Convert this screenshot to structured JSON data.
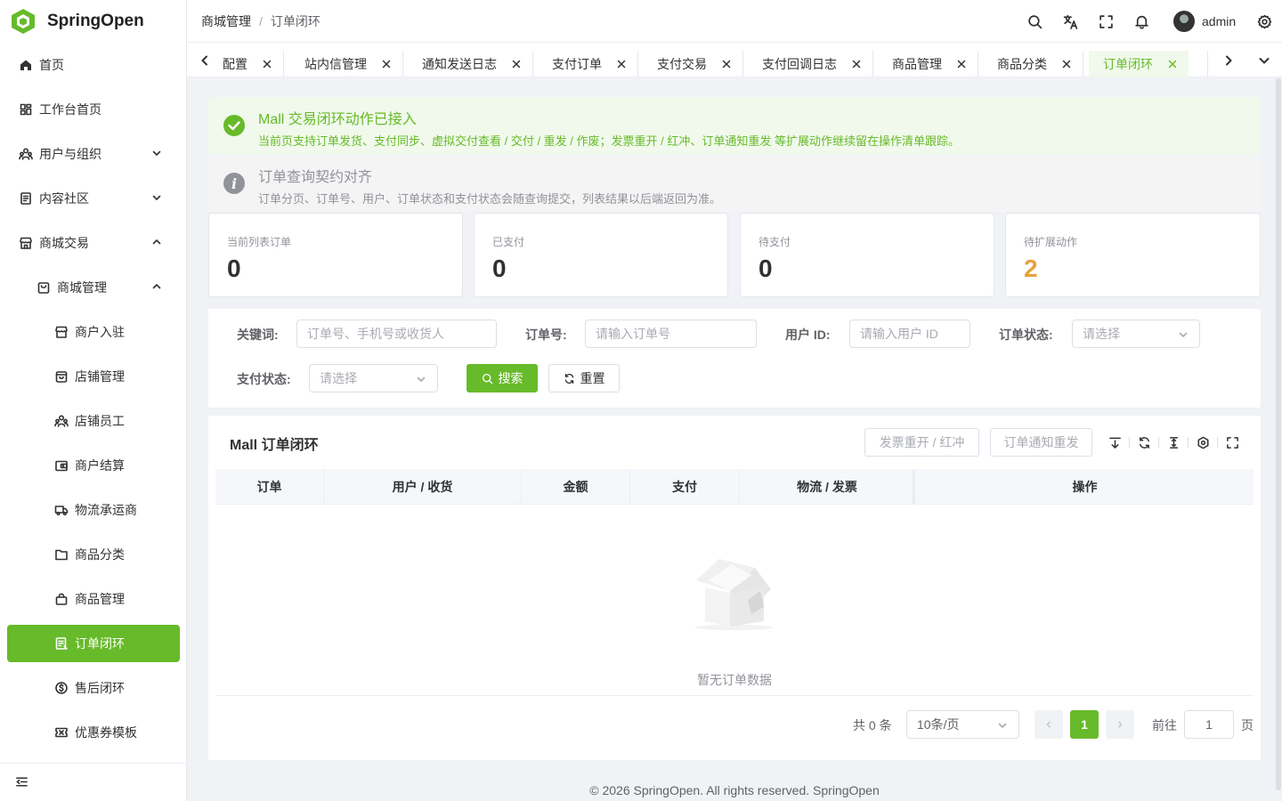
{
  "app": {
    "name": "SpringOpen",
    "brand_color": "#67ba2a"
  },
  "sidebar": {
    "items": [
      {
        "label": "首页",
        "icon": "home-icon"
      },
      {
        "label": "工作台首页",
        "icon": "dashboard-icon"
      },
      {
        "label": "用户与组织",
        "icon": "users-icon",
        "expanded": false
      },
      {
        "label": "内容社区",
        "icon": "document-icon",
        "expanded": false
      },
      {
        "label": "商城交易",
        "icon": "store-icon",
        "expanded": true
      },
      {
        "label": "商城管理",
        "icon": "shopping-bag-icon",
        "expanded": true
      },
      {
        "label": "商户入驻",
        "icon": "storefront-icon"
      },
      {
        "label": "店铺管理",
        "icon": "shop-icon"
      },
      {
        "label": "店铺员工",
        "icon": "staff-icon"
      },
      {
        "label": "商户结算",
        "icon": "wallet-icon"
      },
      {
        "label": "物流承运商",
        "icon": "truck-icon"
      },
      {
        "label": "商品分类",
        "icon": "folder-icon"
      },
      {
        "label": "商品管理",
        "icon": "bag-icon"
      },
      {
        "label": "订单闭环",
        "icon": "order-icon",
        "active": true
      },
      {
        "label": "售后闭环",
        "icon": "refund-icon"
      },
      {
        "label": "优惠券模板",
        "icon": "coupon-icon"
      }
    ]
  },
  "header": {
    "breadcrumb": [
      "商城管理",
      "订单闭环"
    ],
    "username": "admin"
  },
  "tabs": [
    {
      "label": "配置"
    },
    {
      "label": "站内信管理"
    },
    {
      "label": "通知发送日志"
    },
    {
      "label": "支付订单"
    },
    {
      "label": "支付交易"
    },
    {
      "label": "支付回调日志"
    },
    {
      "label": "商品管理"
    },
    {
      "label": "商品分类"
    },
    {
      "label": "订单闭环",
      "active": true
    }
  ],
  "alerts": {
    "success": {
      "title": "Mall 交易闭环动作已接入",
      "desc": "当前页支持订单发货、支付同步、虚拟交付查看 / 交付 / 重发 / 作废；发票重开 / 红冲、订单通知重发 等扩展动作继续留在操作清单跟踪。"
    },
    "info": {
      "title": "订单查询契约对齐",
      "desc": "订单分页、订单号、用户、订单状态和支付状态会随查询提交，列表结果以后端返回为准。"
    }
  },
  "stats": [
    {
      "label": "当前列表订单",
      "value": "0"
    },
    {
      "label": "已支付",
      "value": "0"
    },
    {
      "label": "待支付",
      "value": "0"
    },
    {
      "label": "待扩展动作",
      "value": "2",
      "color": "#e6a23c"
    }
  ],
  "search": {
    "keyword_label": "关键词:",
    "keyword_placeholder": "订单号、手机号或收货人",
    "order_no_label": "订单号:",
    "order_no_placeholder": "请输入订单号",
    "user_id_label": "用户 ID:",
    "user_id_placeholder": "请输入用户 ID",
    "order_status_label": "订单状态:",
    "order_status_placeholder": "请选择",
    "pay_status_label": "支付状态:",
    "pay_status_placeholder": "请选择",
    "search_button": "搜索",
    "reset_button": "重置"
  },
  "table": {
    "title": "Mall 订单闭环",
    "actions": [
      "发票重开 / 红冲",
      "订单通知重发"
    ],
    "columns": [
      "订单",
      "用户 / 收货",
      "金额",
      "支付",
      "物流 / 发票",
      "操作"
    ],
    "empty_text": "暂无订单数据"
  },
  "pagination": {
    "total_text": "共 0 条",
    "page_size": "10条/页",
    "current_page": "1",
    "goto_label": "前往",
    "goto_value": "1",
    "page_suffix": "页"
  },
  "footer": {
    "text": "© 2026 SpringOpen. All rights reserved. SpringOpen"
  }
}
